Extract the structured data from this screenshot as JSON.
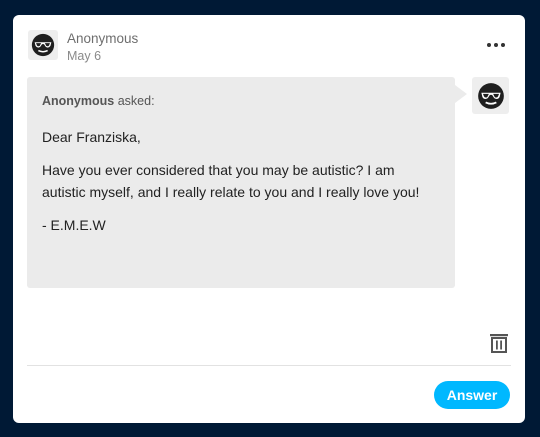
{
  "post": {
    "author": "Anonymous",
    "date": "May 6"
  },
  "menu": {
    "more_icon": "more-horizontal-icon"
  },
  "ask": {
    "asker": "Anonymous",
    "asked_suffix": "asked:",
    "paragraphs": [
      "Dear Franziska,",
      "Have you ever considered that you may be autistic? I am autistic myself, and I really relate to you and I really love you!",
      "- E.M.E.W"
    ]
  },
  "avatar_icon": "anonymous-sunglasses-icon",
  "actions": {
    "delete_icon": "trash-icon",
    "answer_label": "Answer"
  },
  "colors": {
    "background": "#001935",
    "card": "#ffffff",
    "bubble": "#ebebeb",
    "accent": "#00b8ff"
  }
}
